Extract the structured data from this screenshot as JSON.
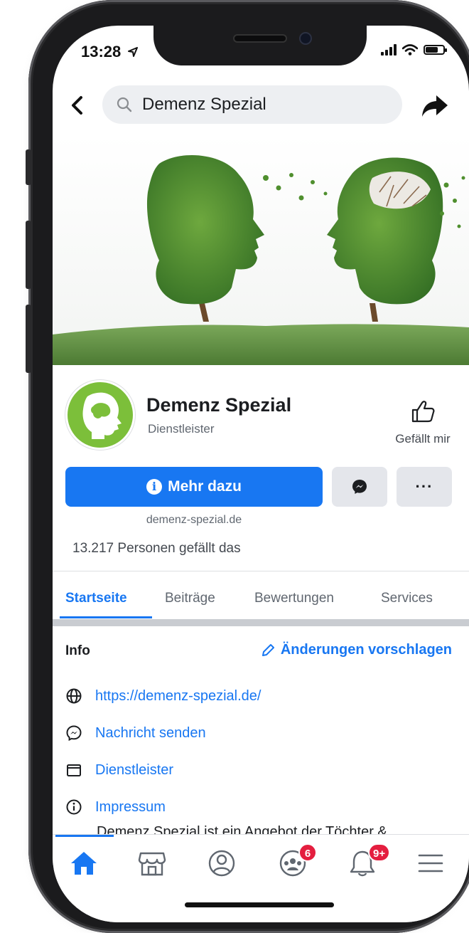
{
  "status_bar": {
    "time": "13:28"
  },
  "search": {
    "query": "Demenz Spezial"
  },
  "page": {
    "name": "Demenz Spezial",
    "category": "Dienstleister",
    "like_label": "Gefällt mir",
    "cta_label": "Mehr dazu",
    "website_short": "demenz-spezial.de",
    "likes_count": "13.217 Personen gefällt das"
  },
  "tabs": [
    {
      "label": "Startseite",
      "active": true
    },
    {
      "label": "Beiträge"
    },
    {
      "label": "Bewertungen"
    },
    {
      "label": "Services"
    }
  ],
  "info": {
    "title": "Info",
    "suggest_label": "Änderungen vorschlagen",
    "items": [
      {
        "icon": "globe-icon",
        "label": "https://demenz-spezial.de/"
      },
      {
        "icon": "messenger-icon",
        "label": "Nachricht senden"
      },
      {
        "icon": "category-icon",
        "label": "Dienstleister"
      },
      {
        "icon": "info-circle-icon",
        "label": "Impressum"
      }
    ],
    "description_partial": "Demenz Spezial ist ein Angebot der Töchter &"
  },
  "bottom_nav": {
    "items": [
      {
        "icon": "home-icon",
        "active": true
      },
      {
        "icon": "marketplace-icon"
      },
      {
        "icon": "profile-icon"
      },
      {
        "icon": "groups-icon",
        "badge": "6"
      },
      {
        "icon": "notifications-icon",
        "badge": "9+"
      },
      {
        "icon": "menu-icon"
      }
    ]
  },
  "colors": {
    "accent": "#1877f2",
    "badge": "#e41e3f",
    "logo_green": "#7cbf3a"
  }
}
